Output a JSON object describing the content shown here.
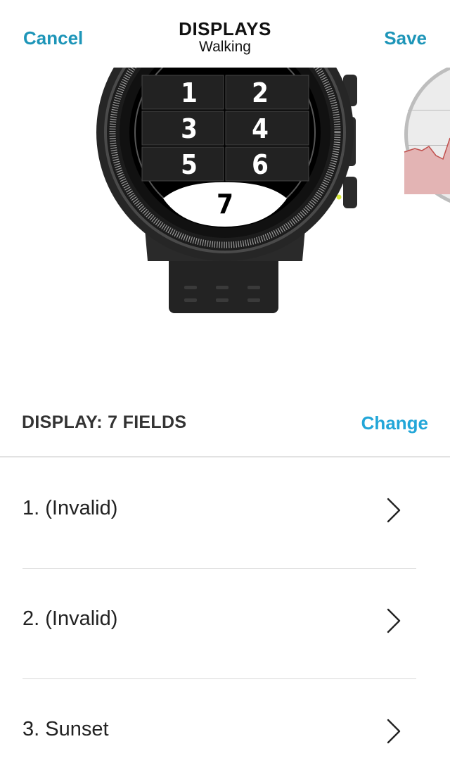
{
  "header": {
    "cancel_label": "Cancel",
    "title": "DISPLAYS",
    "subtitle": "Walking",
    "save_label": "Save"
  },
  "watch": {
    "fields": [
      "1",
      "2",
      "3",
      "4",
      "5",
      "6",
      "7"
    ]
  },
  "display": {
    "label": "DISPLAY: 7 FIELDS",
    "change_label": "Change"
  },
  "field_list": [
    {
      "label": "1. (Invalid)",
      "icon": "chevron-right-icon"
    },
    {
      "label": "2. (Invalid)",
      "icon": "chevron-right-icon"
    },
    {
      "label": "3. Sunset",
      "icon": "chevron-right-icon"
    }
  ],
  "colors": {
    "accent": "#1d95b8",
    "change": "#22a6d8",
    "indicator": "#d8e83a"
  }
}
